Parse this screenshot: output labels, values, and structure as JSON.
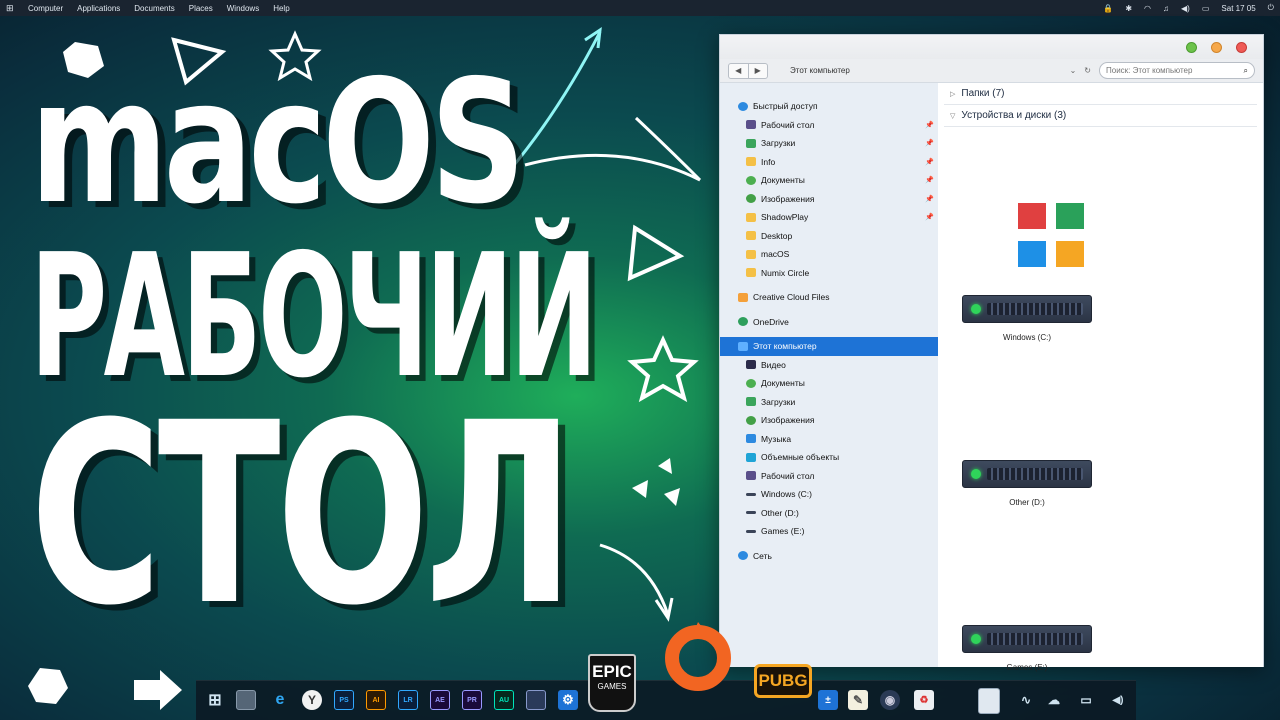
{
  "topbar": {
    "menus": [
      "Computer",
      "Applications",
      "Documents",
      "Places",
      "Windows",
      "Help"
    ],
    "clock": "Sat 17 05"
  },
  "headline": {
    "line1": "macOS",
    "line2": "РАБОЧИЙ",
    "line3": "СТОЛ"
  },
  "explorer": {
    "path": "Этот компьютер",
    "search_placeholder": "Поиск: Этот компьютер",
    "sidebar": {
      "quick_access": "Быстрый доступ",
      "quick_items": [
        "Рабочий стол",
        "Загрузки",
        "Info",
        "Документы",
        "Изображения",
        "ShadowPlay",
        "Desktop",
        "macOS",
        "Numix Circle"
      ],
      "creative_cloud": "Creative Cloud Files",
      "onedrive": "OneDrive",
      "this_pc": "Этот компьютер",
      "pc_items": [
        "Видео",
        "Документы",
        "Загрузки",
        "Изображения",
        "Музыка",
        "Объемные объекты",
        "Рабочий стол",
        "Windows (C:)",
        "Other (D:)",
        "Games (E:)"
      ],
      "network": "Сеть"
    },
    "groups": {
      "folders": "Папки (7)",
      "devices": "Устройства и диски (3)"
    },
    "drives": [
      "Windows (C:)",
      "Other (D:)",
      "Games (E:)"
    ]
  },
  "dock": {
    "epic_line1": "EPIC",
    "epic_line2": "GAMES",
    "pubg": "PUBG",
    "adobe_labels": [
      "PS",
      "AI",
      "LR",
      "AE",
      "PR",
      "AU"
    ]
  },
  "colors": {
    "accent_blue": "#1e73d6",
    "origin_orange": "#f26522",
    "pubg_orange": "#f5a623",
    "drive_led": "#2fd45a"
  }
}
